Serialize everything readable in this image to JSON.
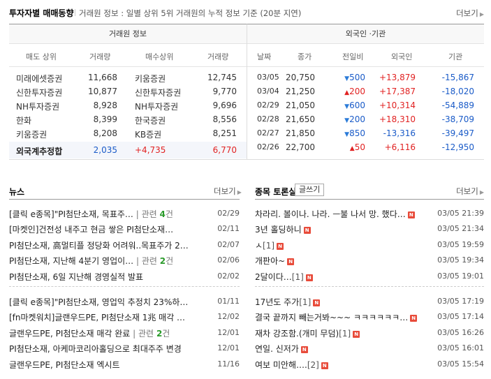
{
  "header": {
    "title": "투자자별 매매동향",
    "subtitle": "거래원 정보 : 일별 상위 5위 거래원의 누적 정보 기준 (20분 지연)",
    "more": "더보기"
  },
  "broker": {
    "caption": "거래원 정보",
    "columns": [
      "매도 상위",
      "거래량",
      "매수상위",
      "거래량"
    ],
    "rows": [
      {
        "sell": "미래에셋증권",
        "sell_vol": "11,668",
        "buy": "키움증권",
        "buy_vol": "12,745"
      },
      {
        "sell": "신한투자증권",
        "sell_vol": "10,877",
        "buy": "신한투자증권",
        "buy_vol": "9,770"
      },
      {
        "sell": "NH투자증권",
        "sell_vol": "8,928",
        "buy": "NH투자증권",
        "buy_vol": "9,696"
      },
      {
        "sell": "한화",
        "sell_vol": "8,399",
        "buy": "한국증권",
        "buy_vol": "8,556"
      },
      {
        "sell": "키움증권",
        "sell_vol": "8,208",
        "buy": "KB증권",
        "buy_vol": "8,251"
      }
    ],
    "total": {
      "name": "외국계추정합",
      "sell_vol": "2,035",
      "diff": "+4,735",
      "buy_vol": "6,770"
    }
  },
  "foreign": {
    "caption": "외국인 ·기관",
    "columns": [
      "날짜",
      "종가",
      "전일비",
      "외국인",
      "기관"
    ],
    "rows": [
      {
        "date": "03/05",
        "close": "20,750",
        "dir": "down",
        "change": "500",
        "foreign": "+13,879",
        "inst": "-15,867"
      },
      {
        "date": "03/04",
        "close": "21,250",
        "dir": "up",
        "change": "200",
        "foreign": "+17,387",
        "inst": "-18,020"
      },
      {
        "date": "02/29",
        "close": "21,050",
        "dir": "down",
        "change": "600",
        "foreign": "+10,314",
        "inst": "-54,889"
      },
      {
        "date": "02/28",
        "close": "21,650",
        "dir": "down",
        "change": "200",
        "foreign": "+18,310",
        "inst": "-38,709"
      },
      {
        "date": "02/27",
        "close": "21,850",
        "dir": "down",
        "change": "850",
        "foreign": "-13,316",
        "inst": "-39,497"
      },
      {
        "date": "02/26",
        "close": "22,700",
        "dir": "up",
        "change": "50",
        "foreign": "+6,116",
        "inst": "-12,950"
      }
    ]
  },
  "news": {
    "title": "뉴스",
    "more": "더보기",
    "related_label": "관련",
    "related_suffix": "건",
    "items": [
      {
        "text": "[클릭 e종목]\"PI첨단소재, 목표주…",
        "related": "4",
        "date": "02/29"
      },
      {
        "text": "[마켓인]건전성 내주고 현금 쌓은 PI첨단소재…",
        "related": "",
        "date": "02/11"
      },
      {
        "text": "PI첨단소재, 高멀티플 정당화 어려워..목표주가 2…",
        "related": "",
        "date": "02/07"
      },
      {
        "text": "PI첨단소재, 지난해 4분기 영업이…",
        "related": "2",
        "date": "02/06"
      },
      {
        "text": "PI첨단소재, 6일 지난해 경영실적 발표",
        "related": "",
        "date": "02/02"
      },
      {
        "text": "[클릭 e종목]\"PI첨단소재, 영업익 추정치 23%하…",
        "related": "",
        "date": "01/11"
      },
      {
        "text": "[fn마켓워치]글랜우드PE, PI첨단소재 1兆 매각 …",
        "related": "",
        "date": "12/02"
      },
      {
        "text": "글랜우드PE, PI첨단소재 매각 완료",
        "related": "2",
        "date": "12/01"
      },
      {
        "text": "PI첨단소재, 아케마코리아홀딩으로 최대주주 변경",
        "related": "",
        "date": "12/01"
      },
      {
        "text": "글랜우드PE, PI첨단소재 엑시트",
        "related": "",
        "date": "11/16"
      }
    ]
  },
  "board": {
    "title": "종목 토론실",
    "write": "글쓰기",
    "more": "더보기",
    "new_badge": "N",
    "items": [
      {
        "text": "차라리. 볼이나. 나라. ㅡ불 나서 망. 했다…",
        "comments": "",
        "date": "03/05 21:39"
      },
      {
        "text": "3년 홀딩하니",
        "comments": "",
        "date": "03/05 21:34"
      },
      {
        "text": "ㅅ",
        "comments": "[1]",
        "date": "03/05 19:59"
      },
      {
        "text": "개판아~",
        "comments": "",
        "date": "03/05 19:34"
      },
      {
        "text": "2달이다…",
        "comments": "[1]",
        "date": "03/05 19:01"
      },
      {
        "text": "17년도 주가",
        "comments": "[1]",
        "date": "03/05 17:19"
      },
      {
        "text": "결국 끝까지 빼는거봐~~~ ㅋㅋㅋㅋㅋㅋ…",
        "comments": "",
        "date": "03/05 17:14"
      },
      {
        "text": "재차 강조함.(개미 무덤)",
        "comments": "[1]",
        "date": "03/05 16:26"
      },
      {
        "text": "연일. 신저가",
        "comments": "",
        "date": "03/05 16:01"
      },
      {
        "text": "여보 미안해….",
        "comments": "[2]",
        "date": "03/05 15:54"
      }
    ]
  },
  "colors": {
    "up": "#e12222",
    "down": "#1a5bc8",
    "related": "#2a9a2a",
    "badge": "#e84b3a"
  }
}
